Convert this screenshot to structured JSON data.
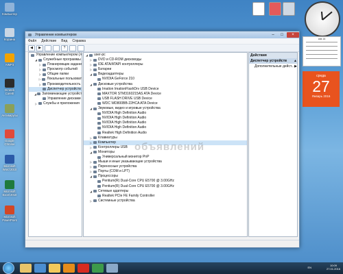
{
  "desktop": {
    "icons": [
      {
        "label": "Компьютер",
        "color": "#8fb3d9"
      },
      {
        "label": "Корзина",
        "color": "#c9d6e4"
      },
      {
        "label": "AIMP3",
        "color": "#f2a300"
      },
      {
        "label": "Dr.Web CureIt!",
        "color": "#2c2c2c"
      },
      {
        "label": "Антивирусы",
        "color": "#8aa05a"
      },
      {
        "label": "Google Chrome",
        "color": "#e14a3b"
      },
      {
        "label": "Microsoft Word 2010",
        "color": "#2b5aa8"
      },
      {
        "label": "Microsoft Excel 2010",
        "color": "#1f7a3d"
      },
      {
        "label": "Microsoft PowerPoint",
        "color": "#d24726"
      }
    ]
  },
  "window": {
    "title": "Управление компьютером",
    "menu": [
      "Файл",
      "Действие",
      "Вид",
      "Справка"
    ],
    "left_tree": [
      {
        "label": "Управление компьютером (л",
        "lvl": 0,
        "exp": ""
      },
      {
        "label": "Служебные программы",
        "lvl": 1,
        "exp": "◢"
      },
      {
        "label": "Планировщик задани",
        "lvl": 2,
        "exp": "▷"
      },
      {
        "label": "Просмотр событий",
        "lvl": 2,
        "exp": "▷"
      },
      {
        "label": "Общие папки",
        "lvl": 2,
        "exp": "▷"
      },
      {
        "label": "Локальные пользоват",
        "lvl": 2,
        "exp": "▷"
      },
      {
        "label": "Производительность",
        "lvl": 2,
        "exp": "▷"
      },
      {
        "label": "Диспетчер устройств",
        "lvl": 2,
        "exp": "",
        "sel": true
      },
      {
        "label": "Запоминающие устройства",
        "lvl": 1,
        "exp": "◢"
      },
      {
        "label": "Управление дисками",
        "lvl": 2,
        "exp": ""
      },
      {
        "label": "Службы и приложения",
        "lvl": 1,
        "exp": "▷"
      }
    ],
    "device_tree": [
      {
        "label": "user-pc",
        "lvl": 0,
        "exp": "◢"
      },
      {
        "label": "DVD и CD-ROM дисководы",
        "lvl": 1,
        "exp": "▷"
      },
      {
        "label": "IDE ATA/ATAPI контроллеры",
        "lvl": 1,
        "exp": "▷"
      },
      {
        "label": "Батареи",
        "lvl": 1,
        "exp": "▷"
      },
      {
        "label": "Видеоадаптеры",
        "lvl": 1,
        "exp": "◢"
      },
      {
        "label": "NVIDIA GeForce 210",
        "lvl": 2,
        "exp": ""
      },
      {
        "label": "Дисковые устройства",
        "lvl": 1,
        "exp": "◢"
      },
      {
        "label": "Imation ImationFlashDrv USB Device",
        "lvl": 2,
        "exp": ""
      },
      {
        "label": "MAXTOR STM3160215AS ATA Device",
        "lvl": 2,
        "exp": ""
      },
      {
        "label": "USB FLASH DRIVE USB Device",
        "lvl": 2,
        "exp": ""
      },
      {
        "label": "WDC WD800BB-22HCA ATA Device",
        "lvl": 2,
        "exp": ""
      },
      {
        "label": "Звуковые, видео и игровые устройства",
        "lvl": 1,
        "exp": "◢"
      },
      {
        "label": "NVIDIA High Definition Audio",
        "lvl": 2,
        "exp": ""
      },
      {
        "label": "NVIDIA High Definition Audio",
        "lvl": 2,
        "exp": ""
      },
      {
        "label": "NVIDIA High Definition Audio",
        "lvl": 2,
        "exp": ""
      },
      {
        "label": "NVIDIA High Definition Audio",
        "lvl": 2,
        "exp": ""
      },
      {
        "label": "Realtek High Definition Audio",
        "lvl": 2,
        "exp": ""
      },
      {
        "label": "Клавиатуры",
        "lvl": 1,
        "exp": "▷"
      },
      {
        "label": "Компьютер",
        "lvl": 1,
        "exp": "▷",
        "sel": true
      },
      {
        "label": "Контроллеры USB",
        "lvl": 1,
        "exp": "▷"
      },
      {
        "label": "Мониторы",
        "lvl": 1,
        "exp": "◢"
      },
      {
        "label": "Универсальный монитор PnP",
        "lvl": 2,
        "exp": ""
      },
      {
        "label": "Мыши и иные указывающие устройства",
        "lvl": 1,
        "exp": "▷"
      },
      {
        "label": "Переносные устройства",
        "lvl": 1,
        "exp": "▷"
      },
      {
        "label": "Порты (COM и LPT)",
        "lvl": 1,
        "exp": "▷"
      },
      {
        "label": "Процессоры",
        "lvl": 1,
        "exp": "◢"
      },
      {
        "label": "Pentium(R) Dual-Core  CPU      E5700  @ 3.00GHz",
        "lvl": 2,
        "exp": ""
      },
      {
        "label": "Pentium(R) Dual-Core  CPU      E5700  @ 3.00GHz",
        "lvl": 2,
        "exp": ""
      },
      {
        "label": "Сетевые адаптеры",
        "lvl": 1,
        "exp": "◢"
      },
      {
        "label": "Realtek PCIe FE Family Controller",
        "lvl": 2,
        "exp": ""
      },
      {
        "label": "Системные устройства",
        "lvl": 1,
        "exp": "▷"
      }
    ],
    "actions": {
      "header": "Действия",
      "sub": "Диспетчер устройств",
      "sub_arrow": "▲",
      "link": "Дополнительные дейст...",
      "link_arrow": "▶"
    }
  },
  "watermark": "объявлений",
  "calendar": {
    "month_small": "янв 16",
    "weekday": "среда",
    "day": "27",
    "month_year": "Январь 2016"
  },
  "taskbar": {
    "lang": "EN",
    "time": "10:09",
    "date": "27.01.2016",
    "items": [
      {
        "name": "explorer",
        "color": "#e9c46a"
      },
      {
        "name": "media",
        "color": "#4b8ed1"
      },
      {
        "name": "folder",
        "color": "#f1c95b"
      },
      {
        "name": "aimp",
        "color": "#e58c1a"
      },
      {
        "name": "yandex",
        "color": "#d62b20"
      },
      {
        "name": "chrome",
        "color": "#3d9a4c"
      },
      {
        "name": "computer-mgmt",
        "color": "#8aa9c8"
      }
    ]
  }
}
